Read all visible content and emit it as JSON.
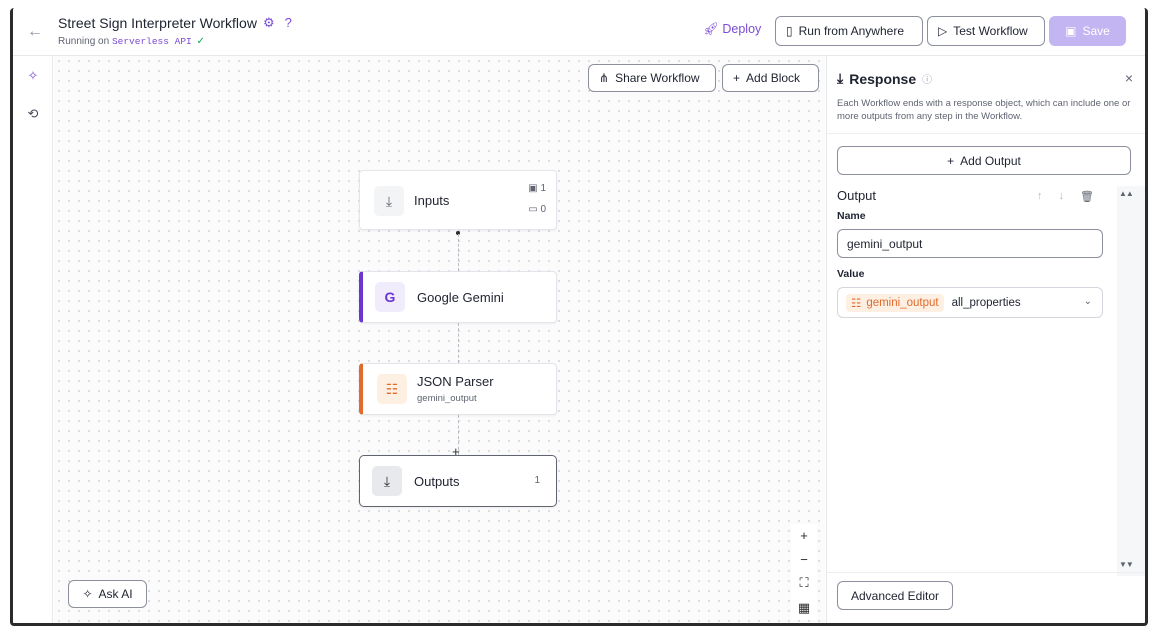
{
  "header": {
    "title": "Street Sign Interpreter Workflow",
    "subtitle_prefix": "Running on",
    "subtitle_env": "Serverless API",
    "deploy_label": "Deploy",
    "run_label": "Run from Anywhere",
    "test_label": "Test Workflow",
    "save_label": "Save",
    "accent_color": "#7b4bd6"
  },
  "canvas": {
    "share_label": "Share Workflow",
    "add_block_label": "Add Block",
    "ask_ai_label": "Ask AI",
    "nodes": {
      "inputs": {
        "label": "Inputs",
        "image_count": "1",
        "param_count": "0"
      },
      "gemini": {
        "label": "Google Gemini",
        "icon_letter": "G",
        "accent": "#6d35d2"
      },
      "json": {
        "label": "JSON Parser",
        "sub": "gemini_output",
        "accent": "#e26a2b"
      },
      "outputs": {
        "label": "Outputs",
        "count": "1"
      }
    }
  },
  "panel": {
    "title": "Response",
    "description": "Each Workflow ends with a response object, which can include one or more outputs from any step in the Workflow.",
    "add_output_label": "Add Output",
    "output_title": "Output",
    "name_label": "Name",
    "name_value": "gemini_output",
    "value_label": "Value",
    "value_chip": "gemini_output",
    "value_prop": "all_properties",
    "advanced_label": "Advanced Editor"
  }
}
